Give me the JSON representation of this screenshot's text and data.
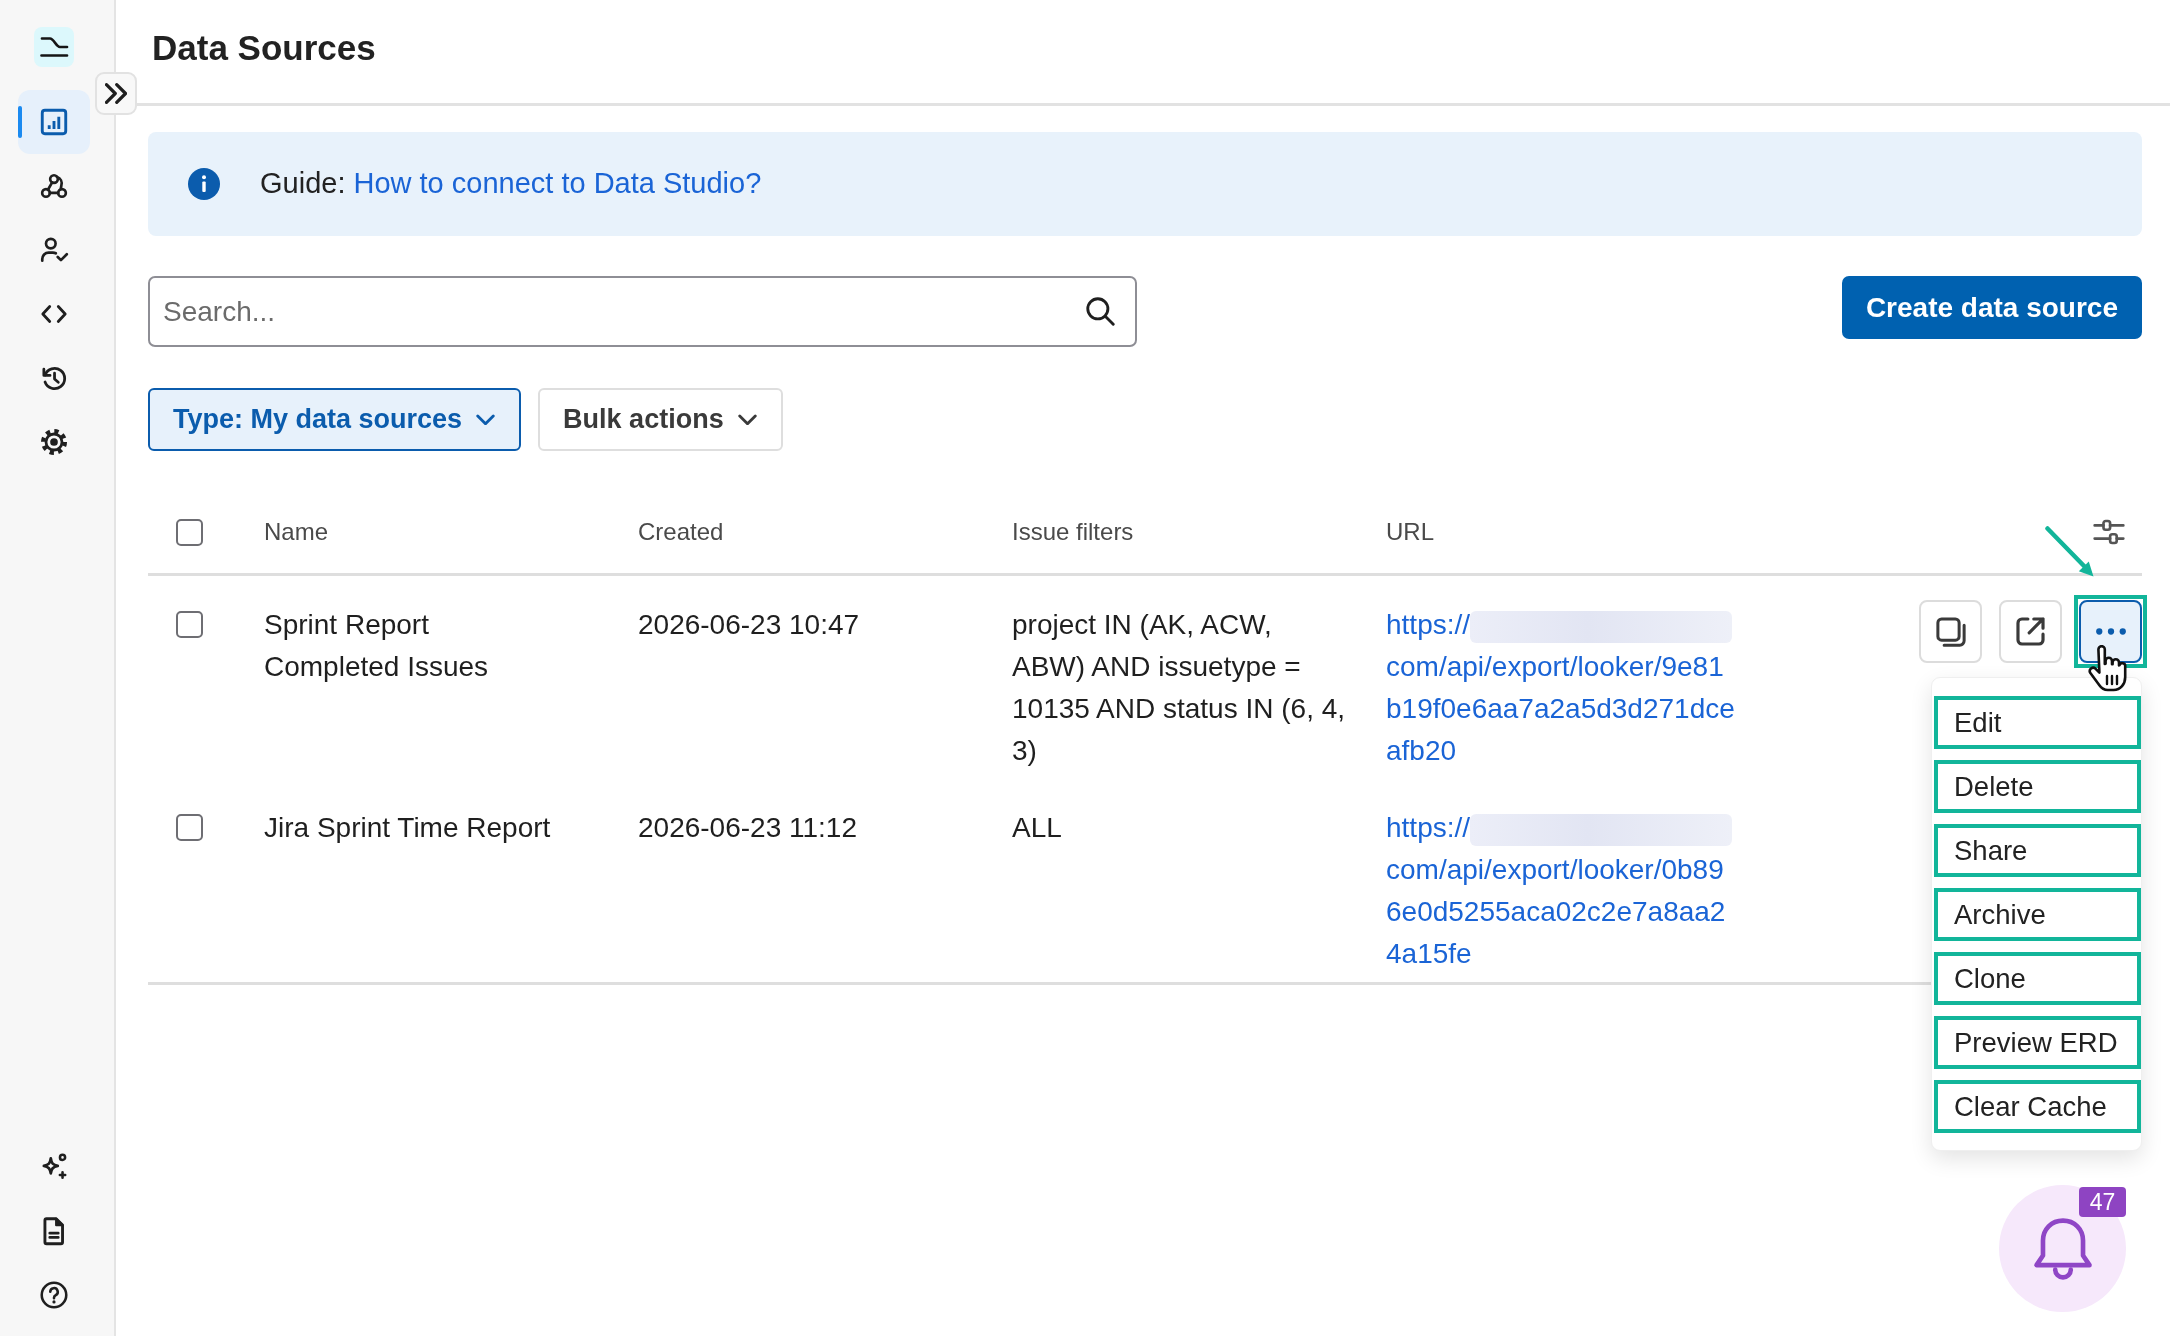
{
  "sidebar": {
    "top_items": [
      {
        "selected": true
      },
      {
        "selected": false
      },
      {
        "selected": false
      },
      {
        "selected": false
      },
      {
        "selected": false
      },
      {
        "selected": false
      }
    ],
    "bottom_items": [
      {
        "selected": false
      },
      {
        "selected": false
      },
      {
        "selected": false
      }
    ]
  },
  "page": {
    "title": "Data Sources"
  },
  "guide": {
    "label": "Guide:",
    "link": "How to connect to Data Studio?"
  },
  "search": {
    "placeholder": "Search..."
  },
  "create_button": "Create data source",
  "filters": [
    {
      "label": "**Type:** My data sources",
      "selected": true
    },
    {
      "label": "Bulk actions",
      "selected": false
    }
  ],
  "table": {
    "select_all": {
      "checked": false
    },
    "columns": [
      "Name",
      "Created",
      "Issue filters",
      "URL"
    ],
    "rows": [
      {
        "selected": false,
        "name": "Sprint Report Completed Issues",
        "created": "2026-06-23 10:47",
        "issue_filters": "project IN (AK, ACW, ABW) AND issuetype = 10135 AND status IN (6, 4, 3)",
        "url": {
          "start": "https://",
          "redacted": true,
          "end": "com/api/export/looker/9e81b19f0e6aa7a2a5d3d271dceafb20"
        },
        "actions": {
          "menu_open": true,
          "highlighted": true,
          "menu": [
            {
              "label": "Edit",
              "highlighted": true
            },
            {
              "label": "Delete",
              "highlighted": true
            },
            {
              "label": "Share",
              "highlighted": true
            },
            {
              "label": "Archive",
              "highlighted": true
            },
            {
              "label": "Clone",
              "highlighted": true
            },
            {
              "label": "Preview ERD",
              "highlighted": true
            },
            {
              "label": "Clear Cache",
              "highlighted": true
            }
          ]
        }
      },
      {
        "selected": false,
        "name": "Jira Sprint Time Report",
        "created": "2026-06-23 11:12",
        "issue_filters": "ALL",
        "url": {
          "start": "https://",
          "redacted": true,
          "end": "com/api/export/looker/0b896e0d5255aca02c2e7a8aa24a15fe"
        }
      }
    ]
  },
  "notifications": {
    "count": "47"
  }
}
